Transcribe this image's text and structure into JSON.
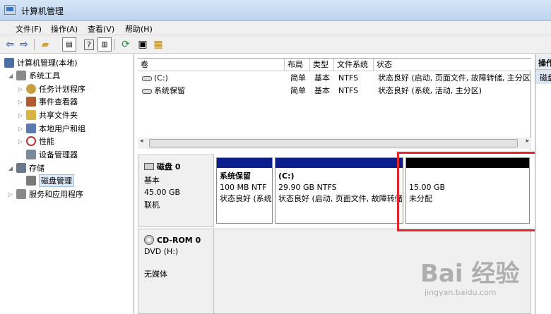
{
  "window": {
    "title": "计算机管理"
  },
  "menu": [
    "文件(F)",
    "操作(A)",
    "查看(V)",
    "帮助(H)"
  ],
  "tree": [
    {
      "label": "计算机管理(本地)",
      "icon": "computer-icon",
      "color": "#4a6fa5"
    },
    {
      "label": "系统工具",
      "icon": "tools-icon",
      "color": "#8a8a8a"
    },
    {
      "label": "任务计划程序",
      "icon": "clock-icon",
      "color": "#c8a040"
    },
    {
      "label": "事件查看器",
      "icon": "event-viewer-icon",
      "color": "#b05a30"
    },
    {
      "label": "共享文件夹",
      "icon": "shared-folder-icon",
      "color": "#d8b440"
    },
    {
      "label": "本地用户和组",
      "icon": "users-icon",
      "color": "#5a7ab0"
    },
    {
      "label": "性能",
      "icon": "performance-icon",
      "color": "#c03030"
    },
    {
      "label": "设备管理器",
      "icon": "device-manager-icon",
      "color": "#7a8a9a"
    },
    {
      "label": "存储",
      "icon": "storage-icon",
      "color": "#6a7a8a"
    },
    {
      "label": "磁盘管理",
      "icon": "disk-management-icon",
      "color": "#7a7a7a"
    },
    {
      "label": "服务和应用程序",
      "icon": "services-icon",
      "color": "#8a8a8a"
    }
  ],
  "volume_table": {
    "headers": [
      "卷",
      "布局",
      "类型",
      "文件系统",
      "状态"
    ],
    "rows": [
      {
        "volume": "(C:)",
        "layout": "简单",
        "type": "基本",
        "fs": "NTFS",
        "status": "状态良好 (启动, 页面文件, 故障转储, 主分区"
      },
      {
        "volume": "系统保留",
        "layout": "简单",
        "type": "基本",
        "fs": "NTFS",
        "status": "状态良好 (系统, 活动, 主分区)"
      }
    ]
  },
  "disks": [
    {
      "name": "磁盘 0",
      "type": "基本",
      "size": "45.00 GB",
      "state": "联机",
      "partitions": [
        {
          "name": "系统保留",
          "size": "100 MB NTF",
          "status": "状态良好 (系统"
        },
        {
          "name": "(C:)",
          "size": "29.90 GB NTFS",
          "status": "状态良好 (启动, 页面文件, 故障转储"
        },
        {
          "name": "",
          "size": "15.00 GB",
          "status": "未分配"
        }
      ]
    },
    {
      "name": "CD-ROM 0",
      "type": "DVD (H:)",
      "state": "无媒体"
    }
  ],
  "actions": {
    "header": "操作",
    "item": "磁盘管理"
  },
  "colors": {
    "partition_bar": "#0a1e8c",
    "unallocated_bar": "#000000",
    "highlight": "#e8232a"
  },
  "watermark": {
    "main": "Bai 经验",
    "url": "jingyan.baidu.com"
  }
}
